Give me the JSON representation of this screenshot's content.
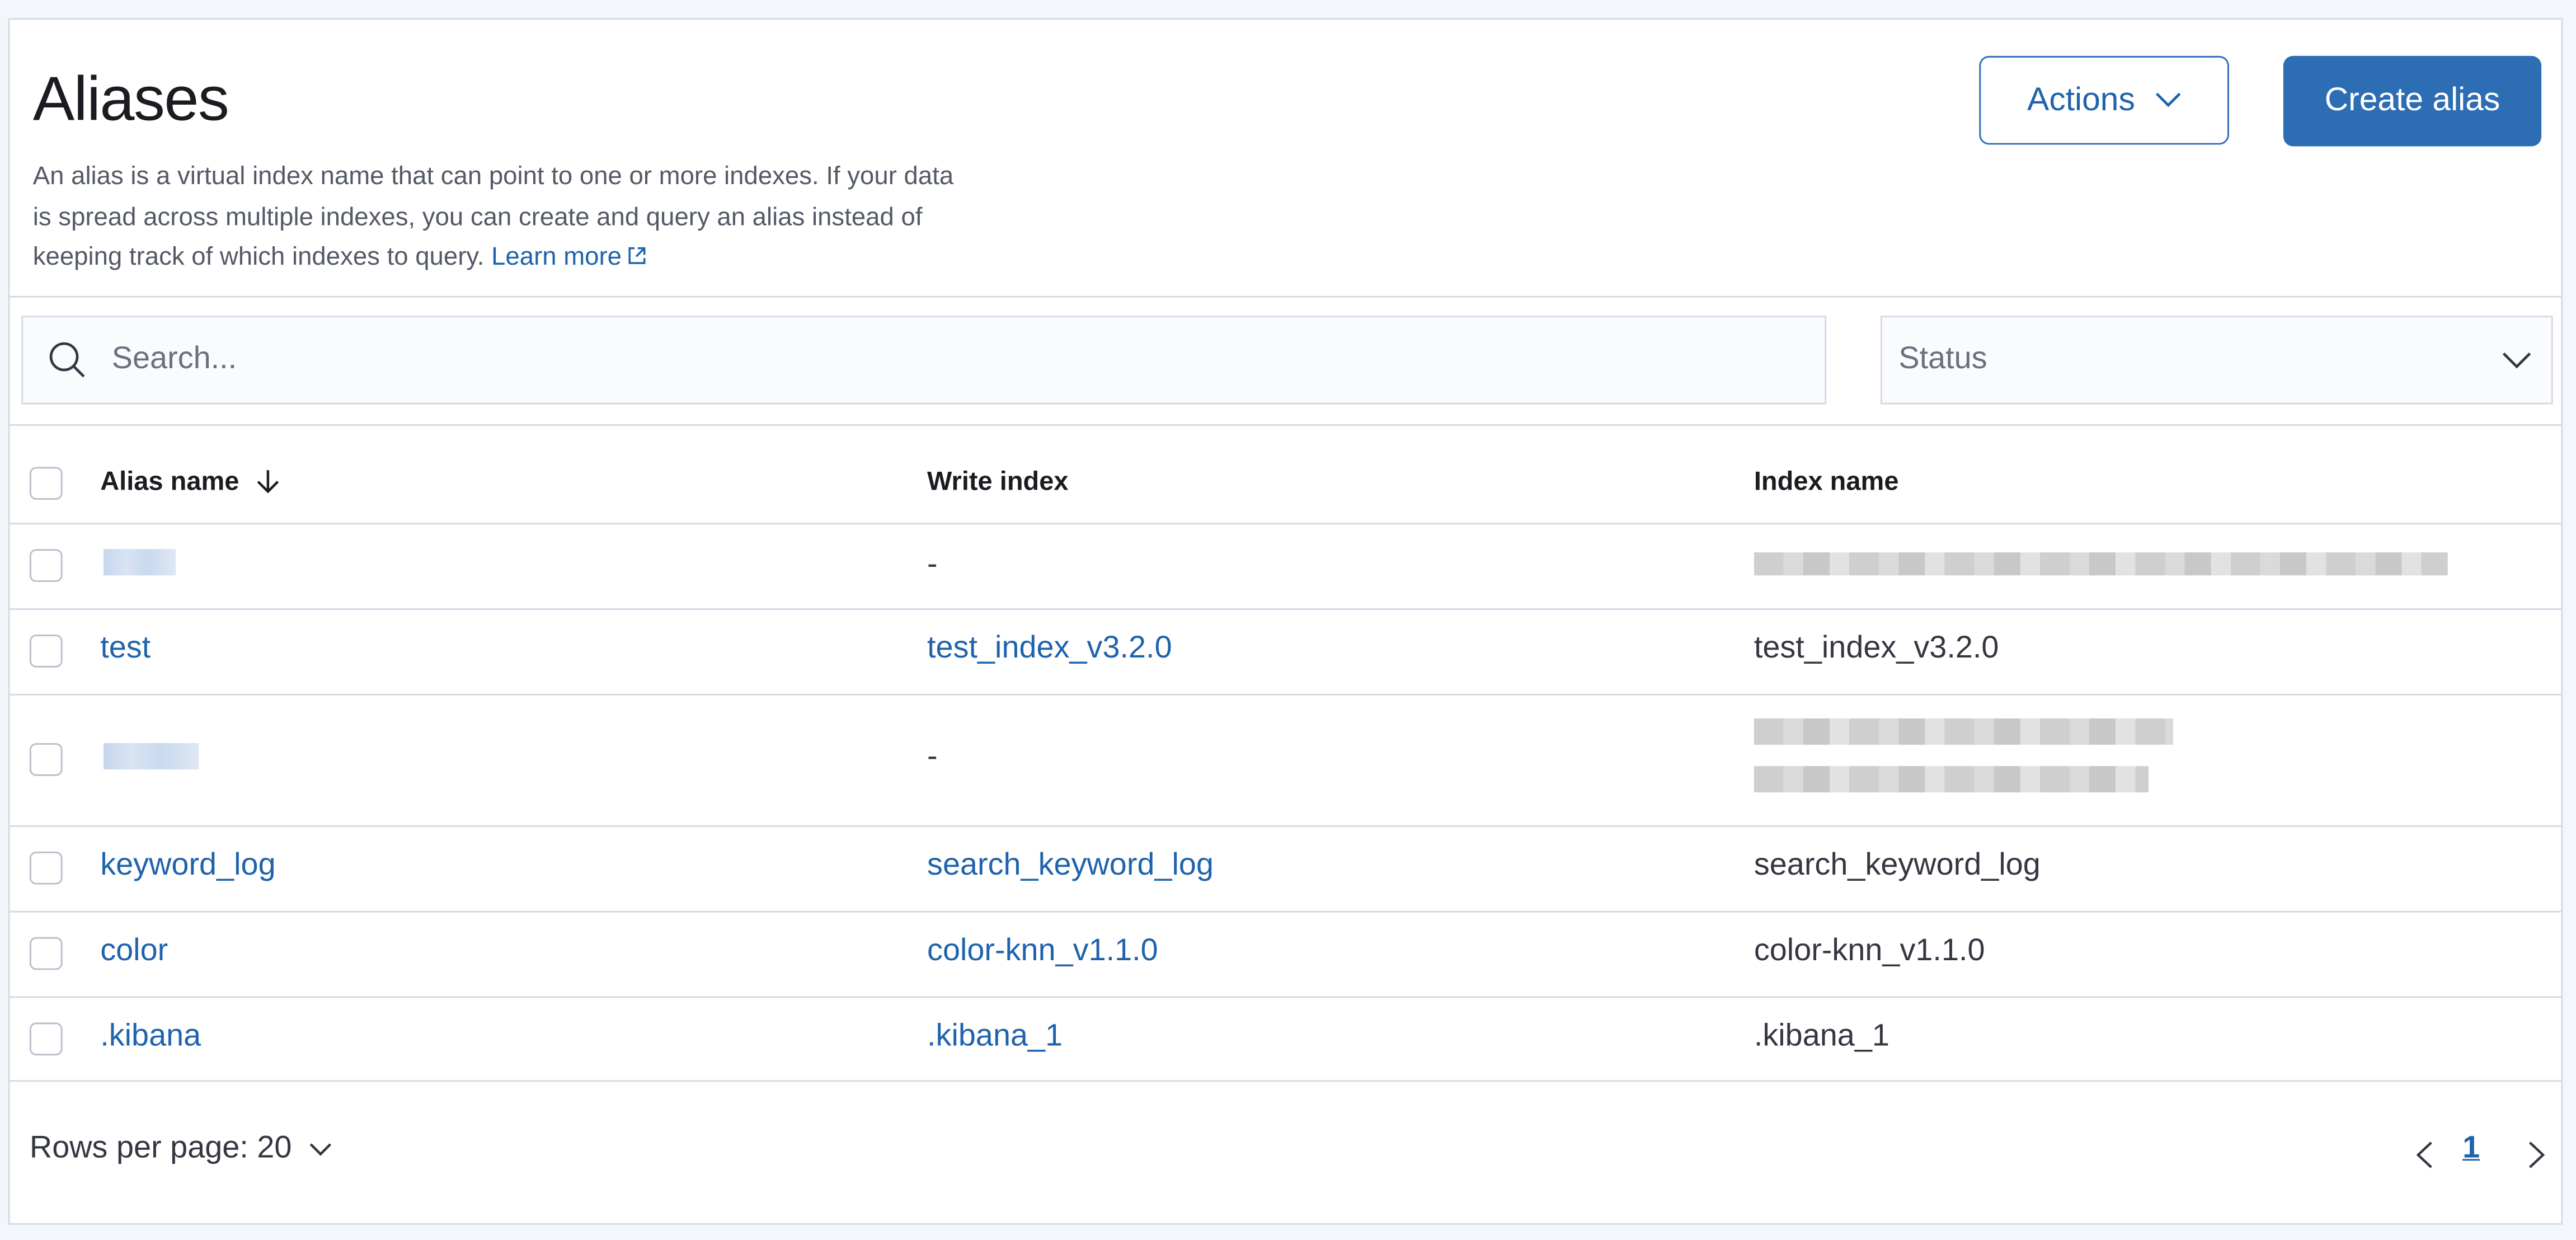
{
  "header": {
    "title": "Aliases",
    "description": "An alias is a virtual index name that can point to one or more indexes. If your data is spread across multiple indexes, you can create and query an alias instead of keeping track of which indexes to query.",
    "learn_more": "Learn more",
    "actions_label": "Actions",
    "create_label": "Create alias"
  },
  "filters": {
    "search_placeholder": "Search...",
    "status_label": "Status"
  },
  "table": {
    "columns": [
      "Alias name",
      "Write index",
      "Index name"
    ],
    "rows": [
      {
        "alias": "",
        "write_index": "-",
        "index_name": ""
      },
      {
        "alias": "test",
        "write_index": "test_index_v3.2.0",
        "index_name": "test_index_v3.2.0"
      },
      {
        "alias": "",
        "write_index": "-",
        "index_name": ""
      },
      {
        "alias": "keyword_log",
        "write_index": "search_keyword_log",
        "index_name": "search_keyword_log"
      },
      {
        "alias": "color",
        "write_index": "color-knn_v1.1.0",
        "index_name": "color-knn_v1.1.0"
      },
      {
        "alias": ".kibana",
        "write_index": ".kibana_1",
        "index_name": ".kibana_1"
      }
    ]
  },
  "footer": {
    "rows_per_page": "Rows per page: 20",
    "current_page": "1"
  },
  "colors": {
    "accent": "#1f63ac",
    "primary_button": "#2c6db4",
    "border": "#d3dae6"
  },
  "icons": [
    "chevron-down-icon",
    "external-link-icon",
    "search-icon",
    "sort-arrow-down-icon",
    "chevron-left-icon",
    "chevron-right-icon"
  ]
}
